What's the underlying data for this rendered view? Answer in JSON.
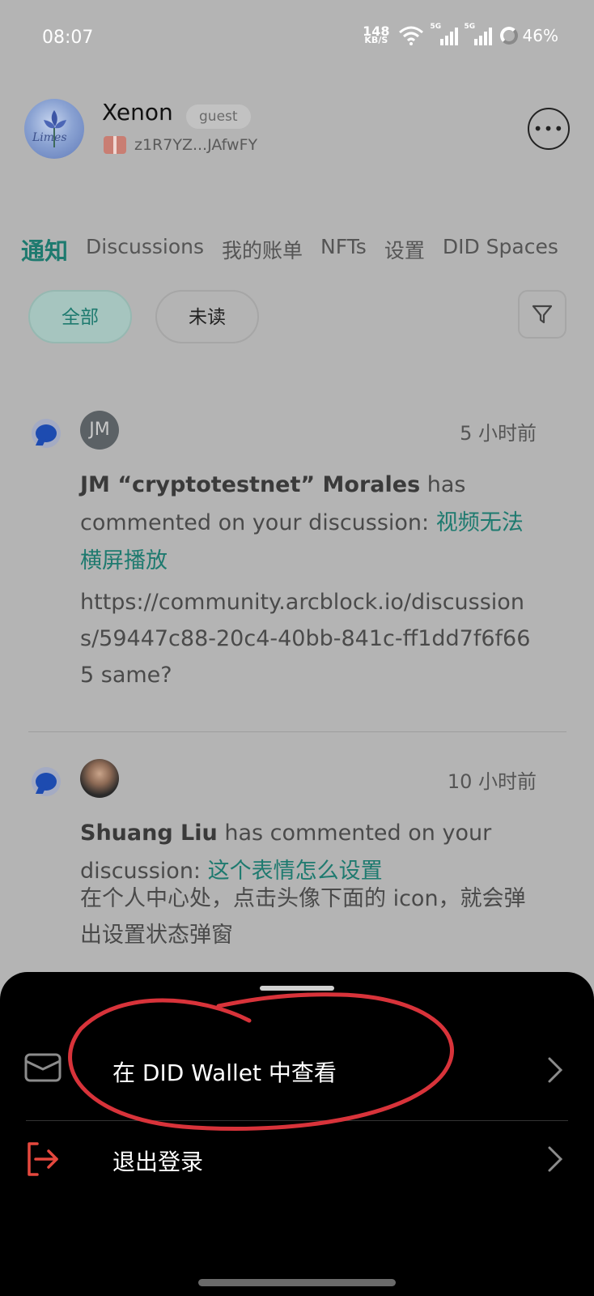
{
  "status_bar": {
    "time": "08:07",
    "net_speed_value": "148",
    "net_speed_unit": "KB/S",
    "signal_tag": "5G",
    "battery": "46%"
  },
  "profile": {
    "name": "Xenon",
    "role_badge": "guest",
    "did": "z1R7YZ...JAfwFY",
    "avatar_logo_text": "Limes"
  },
  "tabs": [
    {
      "label": "通知",
      "active": true
    },
    {
      "label": "Discussions",
      "active": false
    },
    {
      "label": "我的账单",
      "active": false
    },
    {
      "label": "NFTs",
      "active": false
    },
    {
      "label": "设置",
      "active": false
    },
    {
      "label": "DID Spaces",
      "active": false
    }
  ],
  "filters": {
    "all": "全部",
    "unread": "未读",
    "selected": "全部"
  },
  "notifications": [
    {
      "avatar_initials": "JM",
      "time": "5 小时前",
      "actor": "JM “cryptotestnet” Morales",
      "action": " has commented on your discussion: ",
      "topic": "视频无法横屏播放",
      "body": "https://community.arcblock.io/discussions/59447c88-20c4-40bb-841c-ff1dd7f6f665 same?"
    },
    {
      "avatar_initials": "",
      "time": "10 小时前",
      "actor": "Shuang Liu",
      "action": " has commented on your discussion: ",
      "topic": "这个表情怎么设置",
      "body": "在个人中心处，点击头像下面的 icon，就会弹出设置状态弹窗"
    }
  ],
  "sheet": {
    "items": [
      {
        "label": "在 DID Wallet 中查看",
        "icon": "wallet-icon"
      },
      {
        "label": "退出登录",
        "icon": "logout-icon"
      }
    ]
  },
  "colors": {
    "accent": "#1e7a6f",
    "logout": "#e5483e",
    "annotation": "#d8333a"
  }
}
